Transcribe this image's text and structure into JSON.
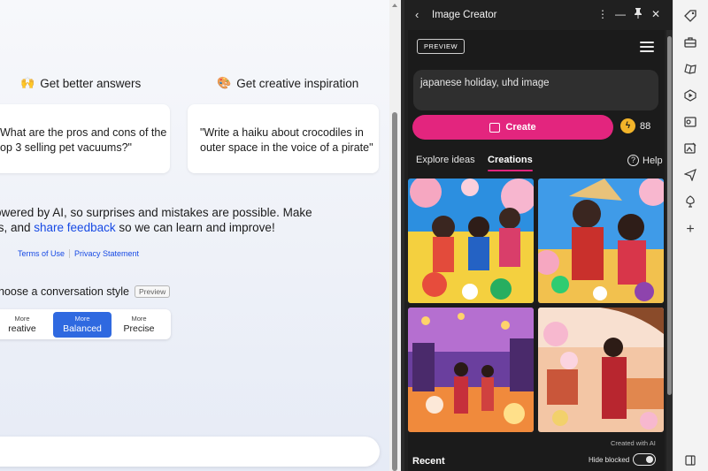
{
  "chat": {
    "headings": [
      {
        "emoji": "🙌",
        "text": "Get better answers"
      },
      {
        "emoji": "🎨",
        "text": "Get creative inspiration"
      }
    ],
    "cards": [
      {
        "line1": "What are the pros and cons of the",
        "line2": "op 3 selling pet vacuums?\""
      },
      {
        "line1": "\"Write a haiku about crocodiles in",
        "line2": "outer space in the voice of a pirate\""
      }
    ],
    "disclaimer": {
      "line1": "owered by AI, so surprises and mistakes are possible. Make",
      "line2_prefix": "ts, and ",
      "line2_link": "share feedback",
      "line2_suffix": " so we can learn and improve!"
    },
    "legal_links": [
      "Terms of Use",
      "Privacy Statement"
    ],
    "style_title": "hoose a conversation style",
    "style_preview_tag": "Preview",
    "styles": [
      {
        "more": "More",
        "name": "reative"
      },
      {
        "more": "More",
        "name": "Balanced"
      },
      {
        "more": "More",
        "name": "Precise"
      }
    ],
    "selected_style": "Balanced"
  },
  "panel": {
    "title": "Image Creator",
    "preview_badge": "PREVIEW",
    "prompt": "japanese holiday, uhd image",
    "create_label": "Create",
    "boosts": "88",
    "tabs": [
      "Explore ideas",
      "Creations"
    ],
    "active_tab": "Creations",
    "help_label": "Help",
    "created_with": "Created with AI",
    "recent_label": "Recent",
    "hide_blocked_label": "Hide blocked",
    "hide_blocked_on": true
  },
  "colors": {
    "accent_pink": "#e3257e",
    "link_blue": "#174ae4",
    "style_active": "#2f69e0",
    "panel_bg": "#1b1b1b"
  },
  "icons": {
    "titlebar": [
      "back-arrow-icon",
      "more-options-icon",
      "minimize-icon",
      "pin-icon",
      "close-icon"
    ],
    "rail": [
      "tag-icon",
      "briefcase-icon",
      "games-icon",
      "play-icon",
      "outlook-icon",
      "image-creator-icon",
      "send-icon",
      "tree-icon",
      "add-icon",
      "sidebar-toggle-icon"
    ]
  }
}
